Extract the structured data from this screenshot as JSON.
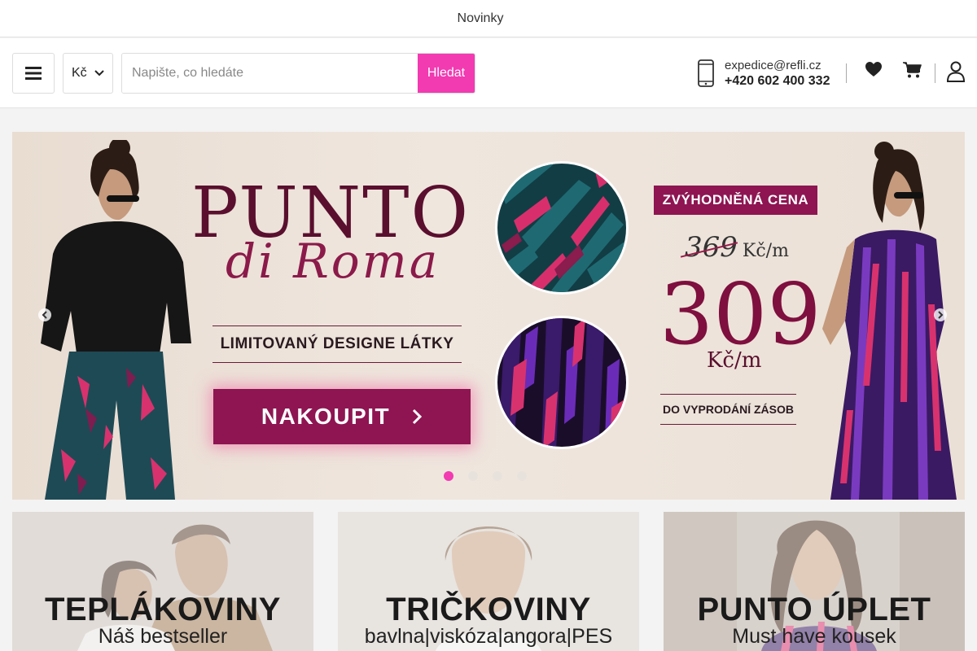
{
  "topbar": {
    "link": "Novinky"
  },
  "header": {
    "currency": "Kč",
    "search_placeholder": "Napište, co hledáte",
    "search_button": "Hledat",
    "email": "expedice@refli.cz",
    "phone": "+420 602 400 332"
  },
  "icons": [
    "menu-icon",
    "chevron-down-icon",
    "phone-icon",
    "heart-icon",
    "cart-icon",
    "user-icon",
    "arrow-left-icon",
    "arrow-right-icon",
    "chevron-right-icon"
  ],
  "hero": {
    "title": "PUNTO",
    "subtitle": "di Roma",
    "limited": "LIMITOVANÝ DESIGNE LÁTKY",
    "cta": "NAKOUPIT",
    "badge": "ZVÝHODNĚNÁ CENA",
    "old_price": "369",
    "old_unit": "Kč/m",
    "new_price": "309",
    "new_unit": "Kč/m",
    "stock_note": "DO VYPRODÁNÍ ZÁSOB",
    "slides": 4,
    "active_slide": 1
  },
  "categories": [
    {
      "title": "TEPLÁKOVINY",
      "subtitle": "Náš bestseller"
    },
    {
      "title": "TRIČKOVINY",
      "subtitle": "bavlna|viskóza|angora|PES"
    },
    {
      "title": "PUNTO ÚPLET",
      "subtitle": "Must have kousek"
    }
  ],
  "colors": {
    "accent": "#f23ab1",
    "brand": "#8e1552",
    "brand_dark": "#5a0f2e"
  }
}
